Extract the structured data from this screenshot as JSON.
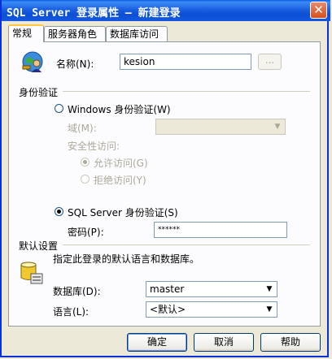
{
  "window": {
    "title": "SQL Server 登录属性 — 新建登录",
    "close_label": "✕"
  },
  "tabs": [
    {
      "label": "常规",
      "active": true
    },
    {
      "label": "服务器角色",
      "active": false
    },
    {
      "label": "数据库访问",
      "active": false
    }
  ],
  "general": {
    "name_label": "名称(N):",
    "name_value": "kesion",
    "browse_label": "...",
    "auth_group_label": "身份验证",
    "windows_auth_label": "Windows 身份验证(W)",
    "domain_label": "域(M):",
    "security_access_label": "安全性访问:",
    "allow_access_label": "允许访问(G)",
    "deny_access_label": "拒绝访问(Y)",
    "sql_auth_label": "SQL Server 身份验证(S)",
    "password_label": "密码(P):",
    "password_value": "******",
    "defaults_group_label": "默认设置",
    "defaults_desc": "指定此登录的默认语言和数据库。",
    "database_label": "数据库(D):",
    "database_value": "master",
    "language_label": "语言(L):",
    "language_value": "<默认>"
  },
  "buttons": {
    "ok": "确定",
    "cancel": "取消",
    "help": "帮助"
  },
  "colors": {
    "titlebar": "#0a4fd4",
    "dialog_bg": "#ece9d8",
    "panel_bg": "#fcfcfe",
    "disabled_text": "#aca899"
  }
}
